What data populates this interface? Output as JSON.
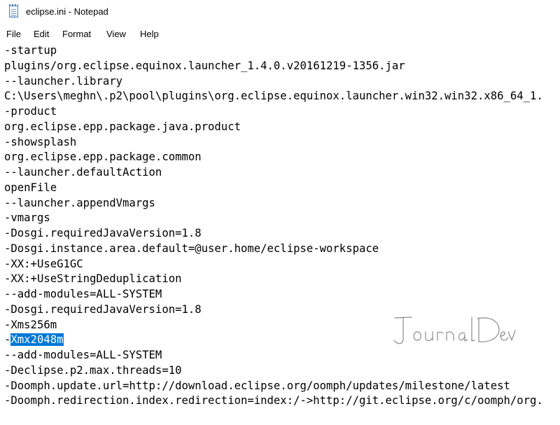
{
  "window": {
    "title": "eclipse.ini - Notepad"
  },
  "menu": {
    "items": [
      {
        "label": "File"
      },
      {
        "label": "Edit"
      },
      {
        "label": "Format"
      },
      {
        "label": "View"
      },
      {
        "label": "Help"
      }
    ]
  },
  "editor": {
    "lines": [
      "-startup",
      "plugins/org.eclipse.equinox.launcher_1.4.0.v20161219-1356.jar",
      "--launcher.library",
      "C:\\Users\\meghn\\.p2\\pool\\plugins\\org.eclipse.equinox.launcher.win32.win32.x86_64_1.",
      "-product",
      "org.eclipse.epp.package.java.product",
      "-showsplash",
      "org.eclipse.epp.package.common",
      "--launcher.defaultAction",
      "openFile",
      "--launcher.appendVmargs",
      "-vmargs",
      "-Dosgi.requiredJavaVersion=1.8",
      "-Dosgi.instance.area.default=@user.home/eclipse-workspace",
      "-XX:+UseG1GC",
      "-XX:+UseStringDeduplication",
      "--add-modules=ALL-SYSTEM",
      "-Dosgi.requiredJavaVersion=1.8",
      "-Xms256m",
      "-Xmx2048m",
      "--add-modules=ALL-SYSTEM",
      "-Declipse.p2.max.threads=10",
      "-Doomph.update.url=http://download.eclipse.org/oomph/updates/milestone/latest",
      "-Doomph.redirection.index.redirection=index:/->http://git.eclipse.org/c/oomph/org."
    ],
    "selection": {
      "line": 19,
      "prefix": "-",
      "text": "Xmx2048m"
    }
  },
  "watermark": {
    "text": "JournalDev"
  },
  "colors": {
    "selection": "#0078d7",
    "watermark": "#8a8a8a"
  }
}
